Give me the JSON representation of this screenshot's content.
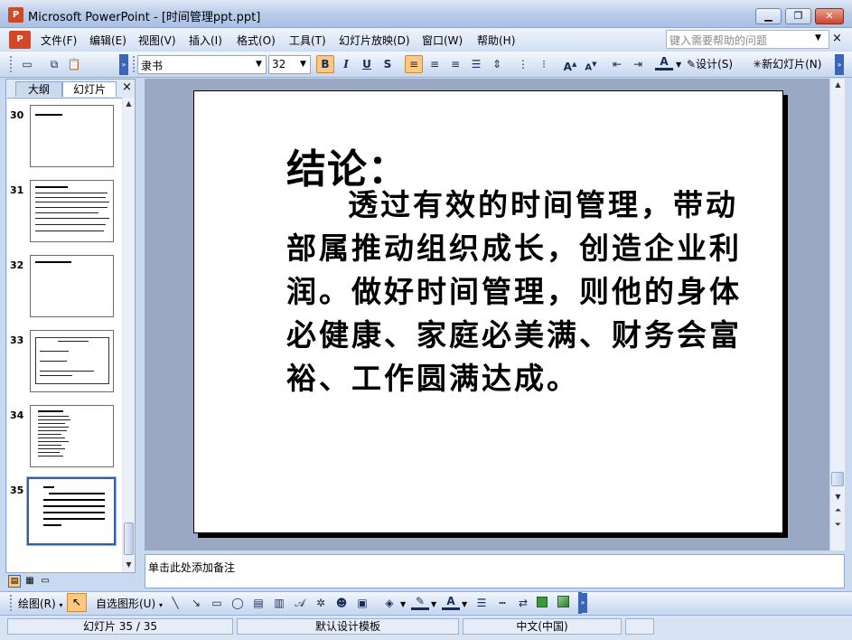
{
  "window": {
    "app_icon": "P",
    "title": "Microsoft PowerPoint - [时间管理ppt.ppt]",
    "minimize": "▁",
    "maximize": "❐",
    "close": "✕"
  },
  "menu": {
    "items": [
      "文件(F)",
      "编辑(E)",
      "视图(V)",
      "插入(I)",
      "格式(O)",
      "工具(T)",
      "幻灯片放映(D)",
      "窗口(W)",
      "帮助(H)"
    ],
    "help_placeholder": "键入需要帮助的问题"
  },
  "toolbar": {
    "font_name": "隶书",
    "font_size": "32",
    "bold": "B",
    "italic": "I",
    "underline": "U",
    "shadow": "S",
    "design_label": "设计(S)",
    "new_slide_label": "新幻灯片(N)"
  },
  "left_pane": {
    "tabs": [
      "大纲",
      "幻灯片"
    ],
    "close": "×",
    "slide_numbers": [
      "30",
      "31",
      "32",
      "33",
      "34",
      "35"
    ],
    "selected_slide": "35"
  },
  "slide": {
    "title": "结论：",
    "body": "透过有效的时间管理，带动部属推动组织成长，创造企业利润。做好时间管理，则他的身体必健康、家庭必美满、财务会富裕、工作圆满达成。"
  },
  "notes": {
    "placeholder": "单击此处添加备注"
  },
  "drawing_toolbar": {
    "draw_label": "绘图(R)",
    "autoshape_label": "自选图形(U)"
  },
  "status": {
    "slide_position": "幻灯片 35 / 35",
    "template": "默认设计模板",
    "language": "中文(中国)"
  },
  "colors": {
    "accent": "#3d65b5",
    "active_button": "#fcc883",
    "slide_area": "#9ba8c4"
  }
}
